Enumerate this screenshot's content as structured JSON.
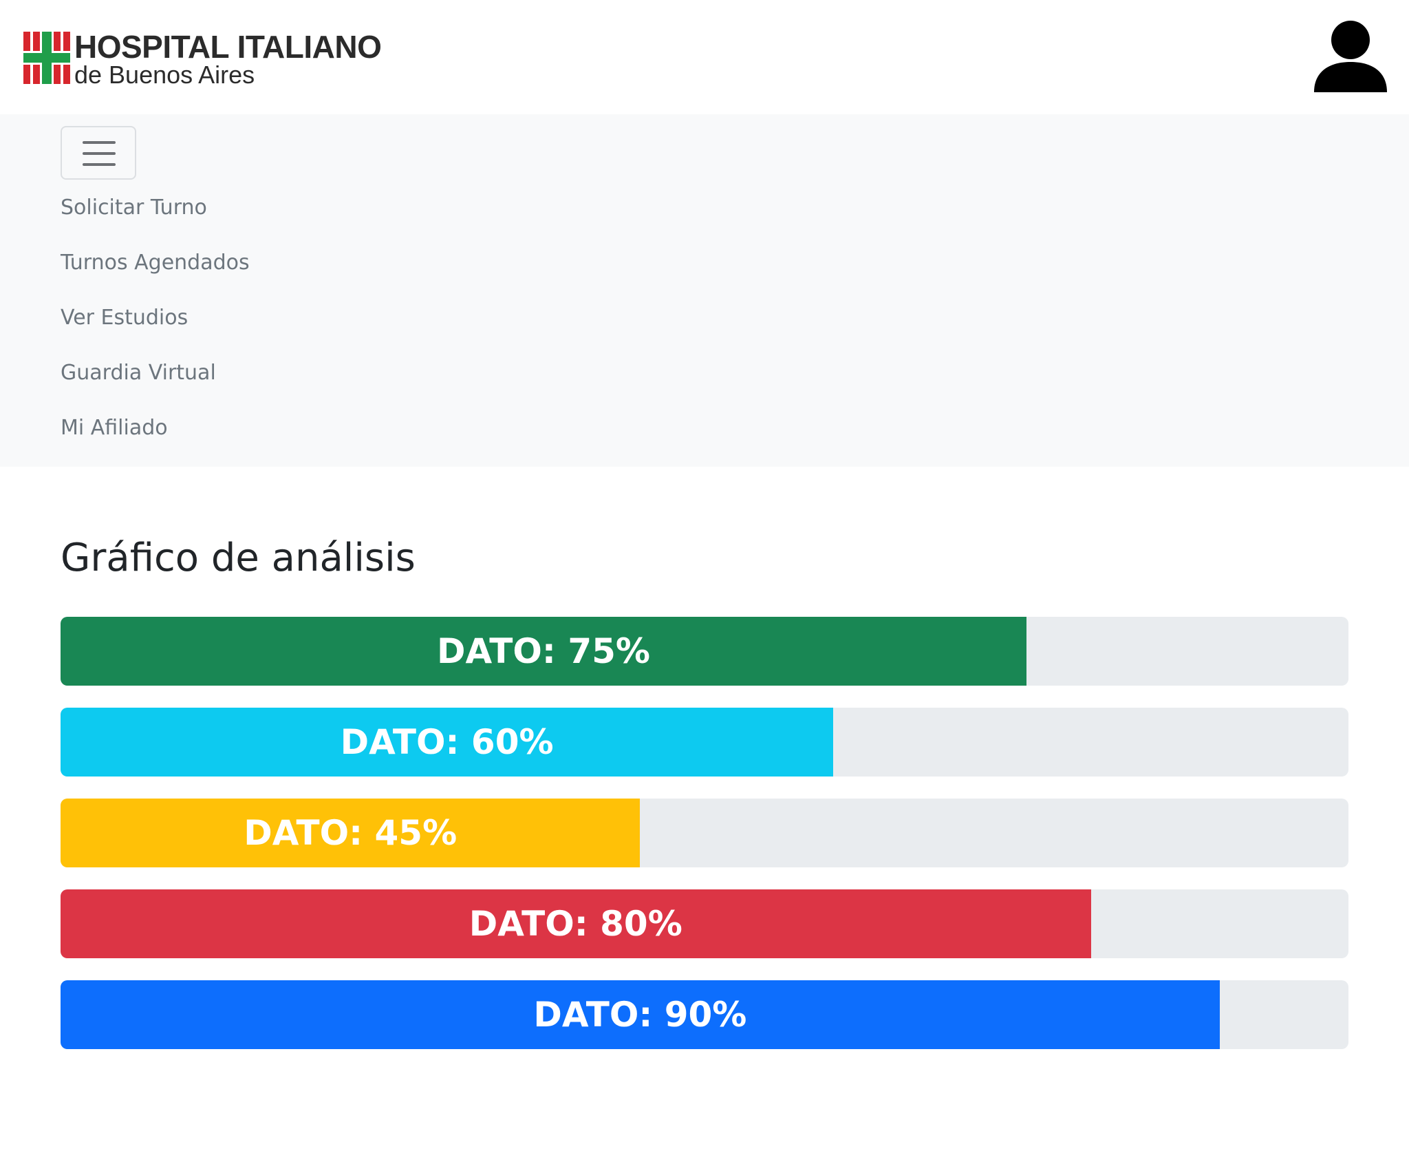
{
  "header": {
    "logo": {
      "title": "HOSPITAL ITALIANO",
      "subtitle": "de Buenos Aires",
      "colors": {
        "red": "#d7262d",
        "green": "#1f9e4a"
      }
    },
    "user_icon": "user-icon"
  },
  "nav": {
    "toggler_icon": "hamburger-menu-icon",
    "items": [
      {
        "label": "Solicitar Turno"
      },
      {
        "label": "Turnos Agendados"
      },
      {
        "label": "Ver Estudios"
      },
      {
        "label": "Guardia Virtual"
      },
      {
        "label": "Mi Afiliado"
      }
    ]
  },
  "main": {
    "title": "Gráfico de análisis",
    "progress_bars": [
      {
        "label": "DATO: 75%",
        "value": 75,
        "color": "#198754"
      },
      {
        "label": "DATO: 60%",
        "value": 60,
        "color": "#0dcaf0"
      },
      {
        "label": "DATO: 45%",
        "value": 45,
        "color": "#ffc107"
      },
      {
        "label": "DATO: 80%",
        "value": 80,
        "color": "#dc3545"
      },
      {
        "label": "DATO: 90%",
        "value": 90,
        "color": "#0d6efd"
      }
    ],
    "track_color": "#e9ecef"
  }
}
